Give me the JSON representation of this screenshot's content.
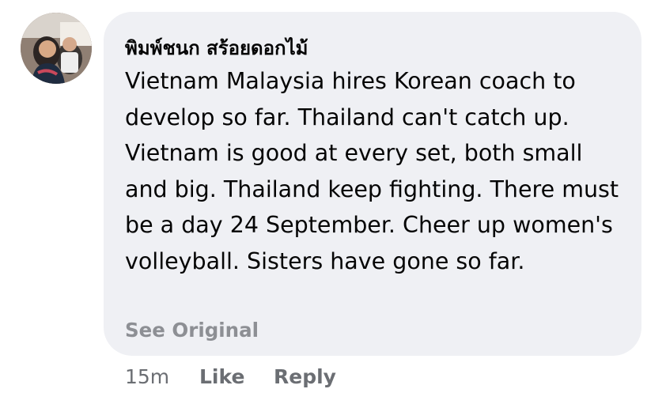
{
  "comment": {
    "author": "พิมพ์ชนก สร้อยดอกไม้",
    "text": "Vietnam Malaysia hires Korean coach to develop so far. Thailand can't catch up. Vietnam is good at every set, both small and big. Thailand keep fighting. There must be a day 24 September. Cheer up women's volleyball. Sisters have gone so far.",
    "see_original_label": "See Original",
    "timestamp": "15m",
    "like_label": "Like",
    "reply_label": "Reply"
  },
  "colors": {
    "bubble": "#eff0f4",
    "text": "#050505",
    "secondary": "#6b6e73",
    "see_original": "#8d8f94"
  },
  "avatar_icon": "profile-photo"
}
